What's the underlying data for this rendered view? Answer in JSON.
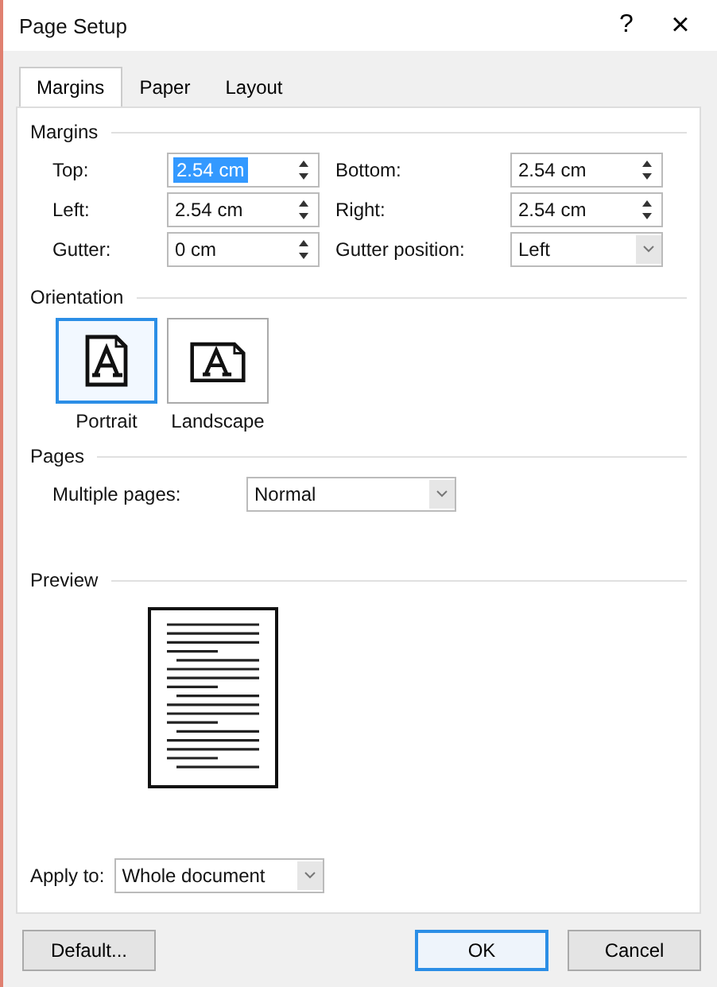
{
  "window": {
    "title": "Page Setup",
    "help": "?",
    "close": "×"
  },
  "tabs": [
    {
      "label": "Margins",
      "selected": true
    },
    {
      "label": "Paper",
      "selected": false
    },
    {
      "label": "Layout",
      "selected": false
    }
  ],
  "margins": {
    "heading": "Margins",
    "fields": [
      {
        "label": "Top:",
        "value": "2.54 cm",
        "kind": "spin",
        "highlighted": true
      },
      {
        "label": "Bottom:",
        "value": "2.54 cm",
        "kind": "spin",
        "highlighted": false
      },
      {
        "label": "Left:",
        "value": "2.54 cm",
        "kind": "spin",
        "highlighted": false
      },
      {
        "label": "Right:",
        "value": "2.54 cm",
        "kind": "spin",
        "highlighted": false
      },
      {
        "label": "Gutter:",
        "value": "0 cm",
        "kind": "spin",
        "highlighted": false
      },
      {
        "label": "Gutter position:",
        "value": "Left",
        "kind": "dropdown",
        "highlighted": false
      }
    ]
  },
  "orientation": {
    "heading": "Orientation",
    "options": [
      {
        "label": "Portrait",
        "kind": "portrait",
        "selected": true
      },
      {
        "label": "Landscape",
        "kind": "landscape",
        "selected": false
      }
    ]
  },
  "pages": {
    "heading": "Pages",
    "label": "Multiple pages:",
    "value": "Normal"
  },
  "preview": {
    "heading": "Preview"
  },
  "apply_to": {
    "label": "Apply to:",
    "value": "Whole document"
  },
  "buttons": [
    {
      "label": "Default...",
      "kind": "left",
      "default": false
    },
    {
      "label": "OK",
      "kind": "right",
      "default": true
    },
    {
      "label": "Cancel",
      "kind": "right",
      "default": false
    }
  ]
}
